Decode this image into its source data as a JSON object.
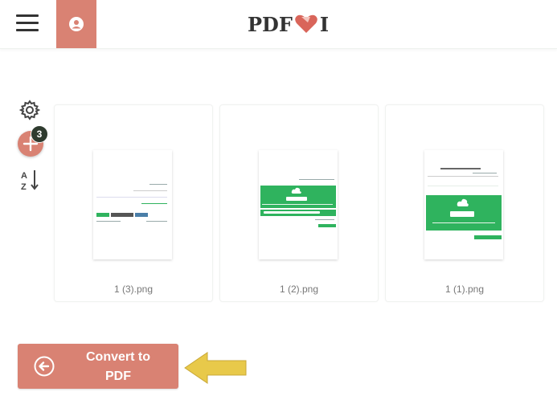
{
  "header": {
    "menu_icon": "hamburger-menu-icon",
    "user_icon": "user-circle-icon",
    "logo_text_left": "I",
    "logo_text_right": "PDF",
    "brand_color": "#d98273"
  },
  "tools": {
    "settings_icon": "gear-icon",
    "add_icon": "plus-icon",
    "file_count": "3",
    "sort_icon": "sort-az-icon",
    "sort_top": "A",
    "sort_bottom": "Z"
  },
  "files": [
    {
      "name": "1 (3).png"
    },
    {
      "name": "1 (2).png"
    },
    {
      "name": "1 (1).png"
    }
  ],
  "convert": {
    "line1": "Convert to",
    "line2": "PDF",
    "icon": "arrow-left-circle-icon"
  },
  "annotation": {
    "icon": "yellow-arrow-icon",
    "color": "#e8c94a"
  }
}
